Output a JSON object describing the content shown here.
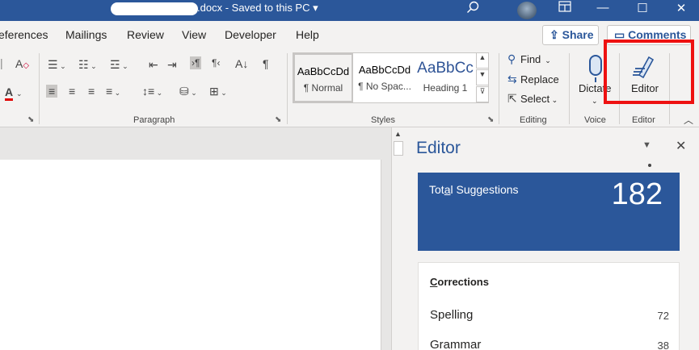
{
  "titlebar": {
    "doc_suffix": ".docx",
    "saved_status": "Saved to this PC",
    "status_caret": "▾",
    "search_icon": "search-icon",
    "min_glyph": "—",
    "max_glyph": "☐",
    "close_glyph": "✕",
    "accent": "#2b579a"
  },
  "menu": {
    "tabs": [
      "eferences",
      "Mailings",
      "Review",
      "View",
      "Developer",
      "Help"
    ],
    "share_label": "Share",
    "comments_label": "Comments"
  },
  "ribbon": {
    "paragraph_label": "Paragraph",
    "styles_label": "Styles",
    "editing_label": "Editing",
    "voice_label": "Voice",
    "editor_label": "Editor",
    "styles": [
      {
        "sample": "AaBbCcDd",
        "name": "¶ Normal"
      },
      {
        "sample": "AaBbCcDd",
        "name": "¶ No Spac..."
      },
      {
        "sample": "AaBbCc",
        "name": "Heading 1"
      }
    ],
    "find_label": "Find",
    "replace_label": "Replace",
    "select_label": "Select",
    "dictate_label": "Dictate",
    "editor_button_label": "Editor",
    "highlight_color": "#ee1111"
  },
  "editor_pane": {
    "title": "Editor",
    "total_label_pre": "Tot",
    "total_label_u": "a",
    "total_label_post": "l Suggestions",
    "total_count": "182",
    "corrections_heading_u": "C",
    "corrections_heading_rest": "orrections",
    "rows": [
      {
        "label": "Spelling",
        "count": "72"
      },
      {
        "label": "Grammar",
        "count": "38"
      }
    ]
  }
}
